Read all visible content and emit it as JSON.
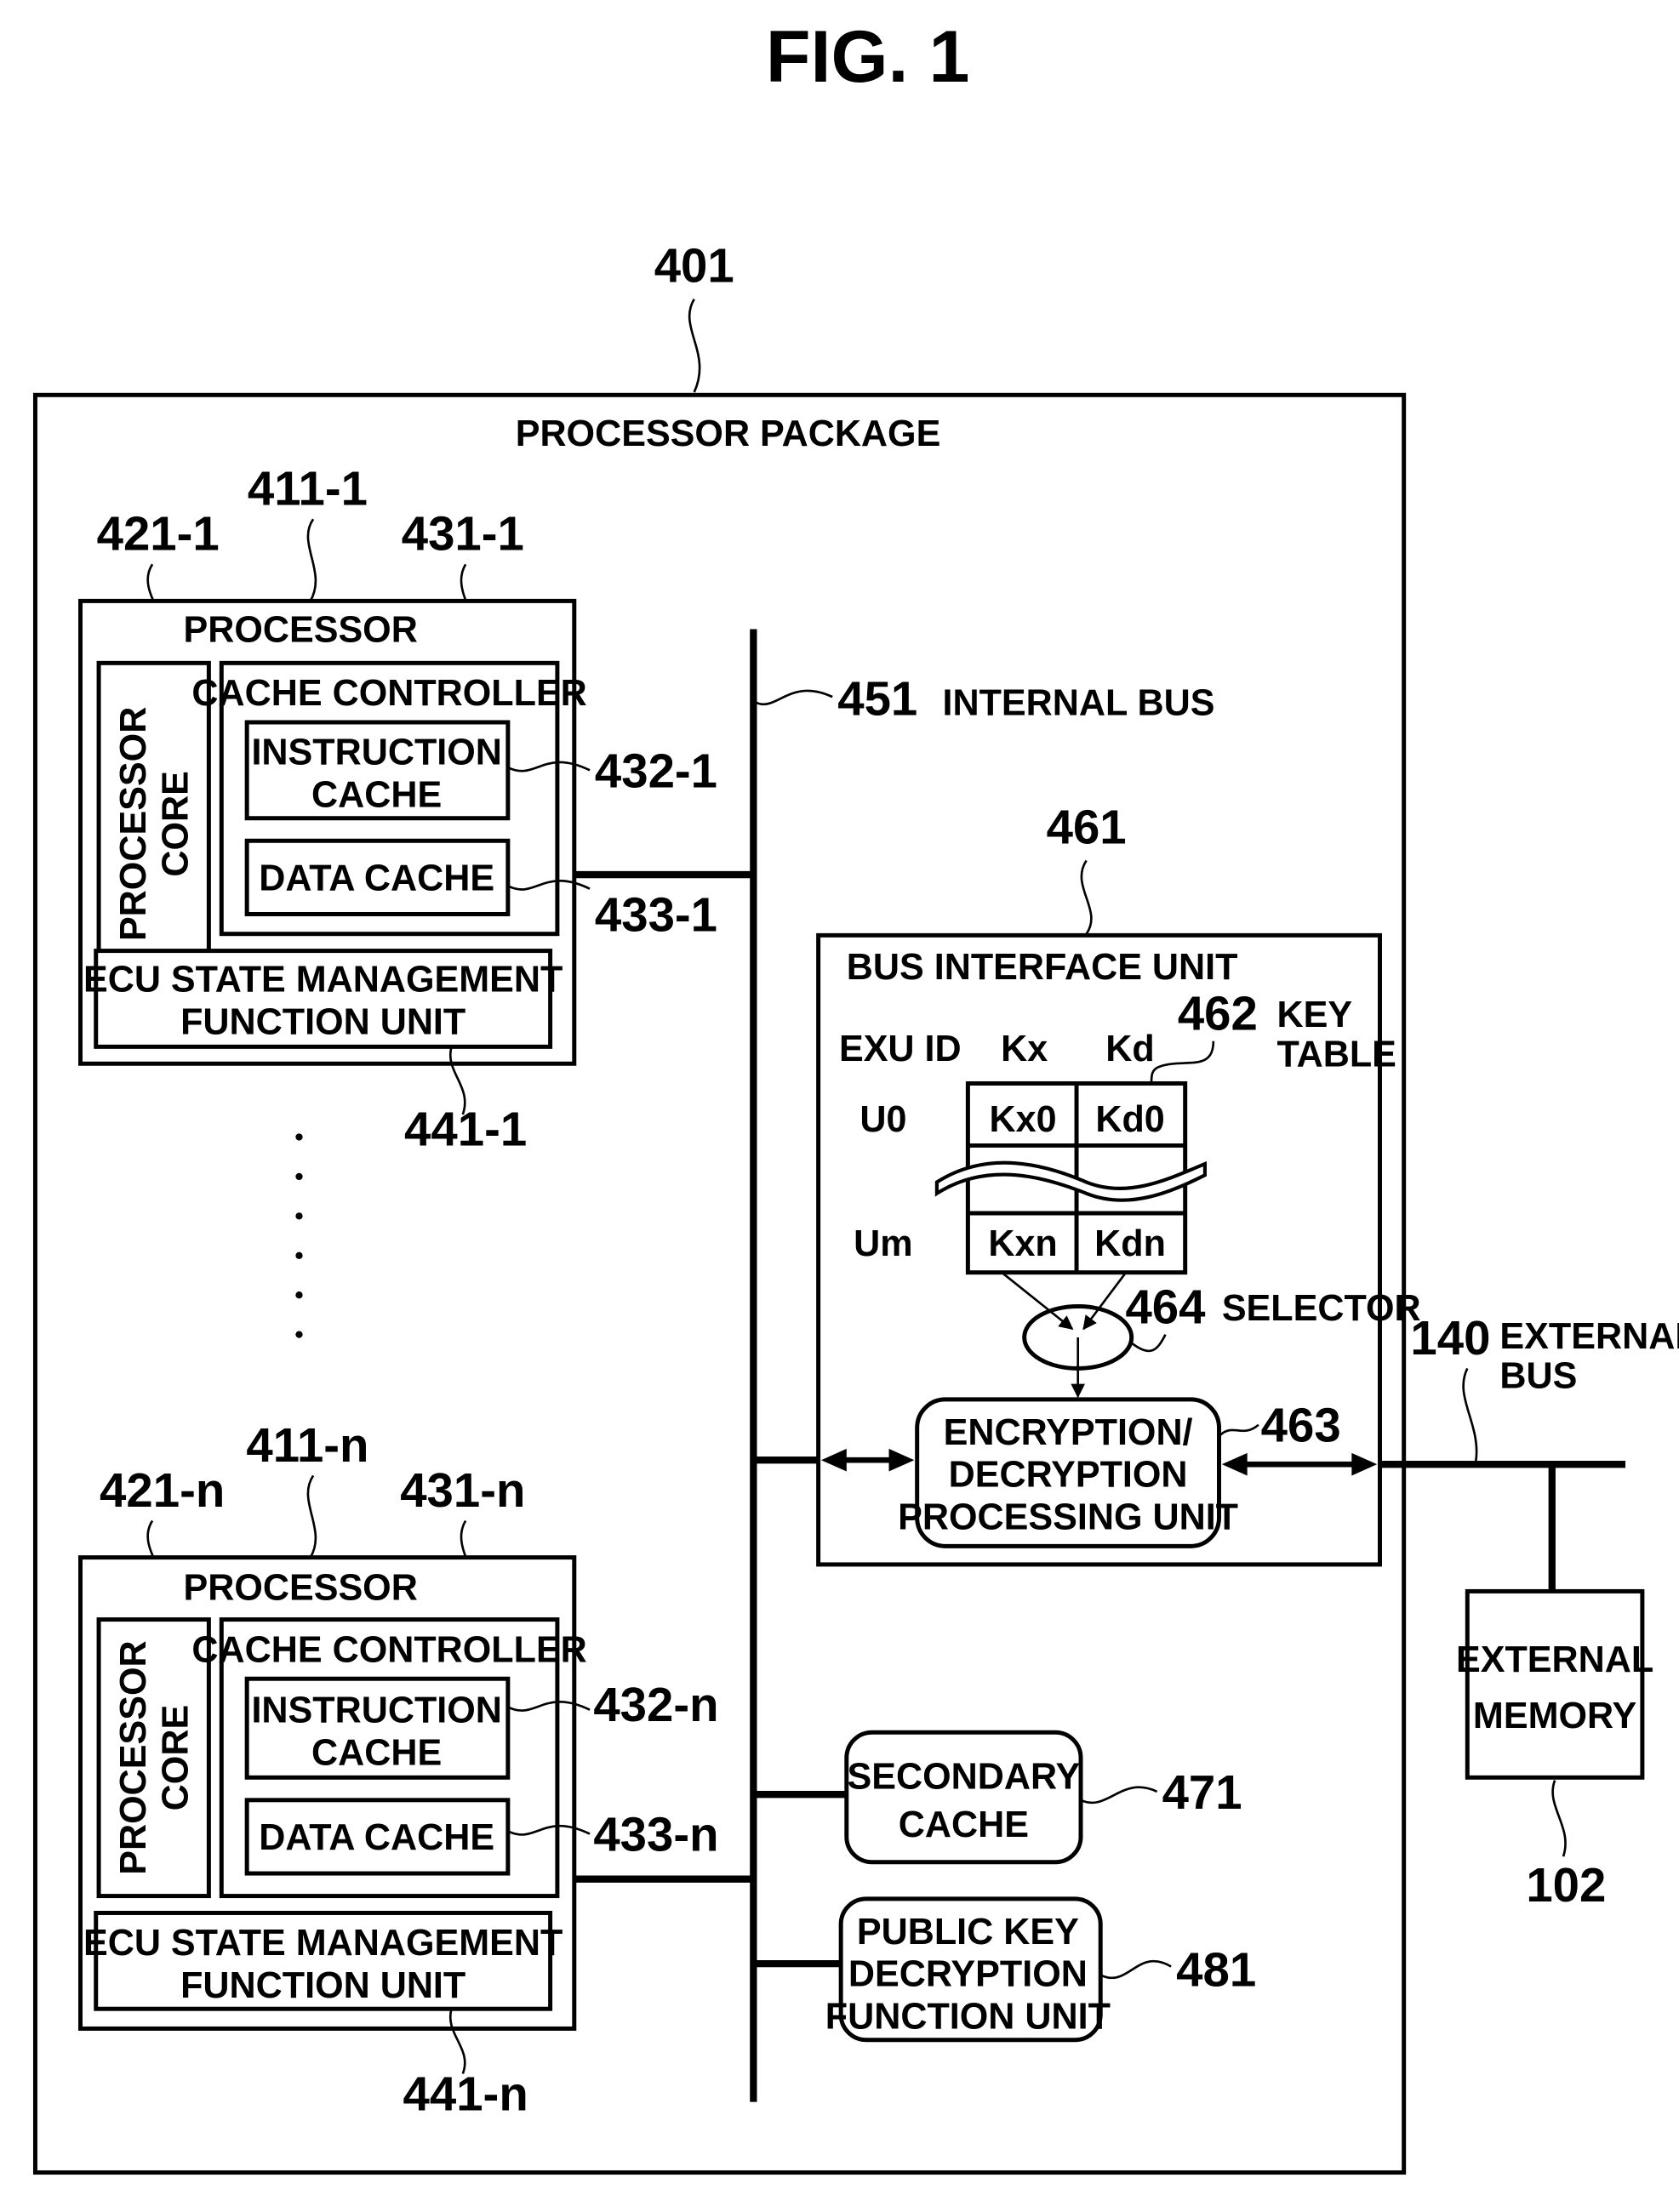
{
  "figure": {
    "title": "FIG. 1"
  },
  "package": {
    "ref": "401",
    "label": "PROCESSOR PACKAGE"
  },
  "processors": [
    {
      "ref": "411-1",
      "label": "PROCESSOR",
      "core": {
        "ref": "421-1",
        "label_line1": "PROCESSOR",
        "label_line2": "CORE"
      },
      "cache_controller": {
        "ref": "431-1",
        "label": "CACHE CONTROLLER"
      },
      "instruction_cache": {
        "ref": "432-1",
        "label_line1": "INSTRUCTION",
        "label_line2": "CACHE"
      },
      "data_cache": {
        "ref": "433-1",
        "label": "DATA CACHE"
      },
      "ecu": {
        "ref": "441-1",
        "label_line1": "ECU STATE MANAGEMENT",
        "label_line2": "FUNCTION UNIT"
      }
    },
    {
      "ref": "411-n",
      "label": "PROCESSOR",
      "core": {
        "ref": "421-n",
        "label_line1": "PROCESSOR",
        "label_line2": "CORE"
      },
      "cache_controller": {
        "ref": "431-n",
        "label": "CACHE CONTROLLER"
      },
      "instruction_cache": {
        "ref": "432-n",
        "label_line1": "INSTRUCTION",
        "label_line2": "CACHE"
      },
      "data_cache": {
        "ref": "433-n",
        "label": "DATA CACHE"
      },
      "ecu": {
        "ref": "441-n",
        "label_line1": "ECU STATE MANAGEMENT",
        "label_line2": "FUNCTION UNIT"
      }
    }
  ],
  "internal_bus": {
    "ref": "451",
    "label": "INTERNAL BUS"
  },
  "bus_interface": {
    "ref": "461",
    "label": "BUS INTERFACE UNIT",
    "key_table": {
      "ref": "462",
      "label_line1": "KEY",
      "label_line2": "TABLE",
      "headers": [
        "EXU ID",
        "Kx",
        "Kd"
      ],
      "rows": [
        {
          "id": "U0",
          "kx": "Kx0",
          "kd": "Kd0"
        },
        {
          "id": "Um",
          "kx": "Kxn",
          "kd": "Kdn"
        }
      ]
    },
    "selector": {
      "ref": "464",
      "label": "SELECTOR"
    },
    "crypto": {
      "ref": "463",
      "label_line1": "ENCRYPTION/",
      "label_line2": "DECRYPTION",
      "label_line3": "PROCESSING UNIT"
    }
  },
  "secondary_cache": {
    "ref": "471",
    "label_line1": "SECONDARY",
    "label_line2": "CACHE"
  },
  "public_key": {
    "ref": "481",
    "label_line1": "PUBLIC KEY",
    "label_line2": "DECRYPTION",
    "label_line3": "FUNCTION UNIT"
  },
  "external_bus": {
    "ref": "140",
    "label_line1": "EXTERNAL",
    "label_line2": "BUS"
  },
  "external_memory": {
    "ref": "102",
    "label_line1": "EXTERNAL",
    "label_line2": "MEMORY"
  }
}
